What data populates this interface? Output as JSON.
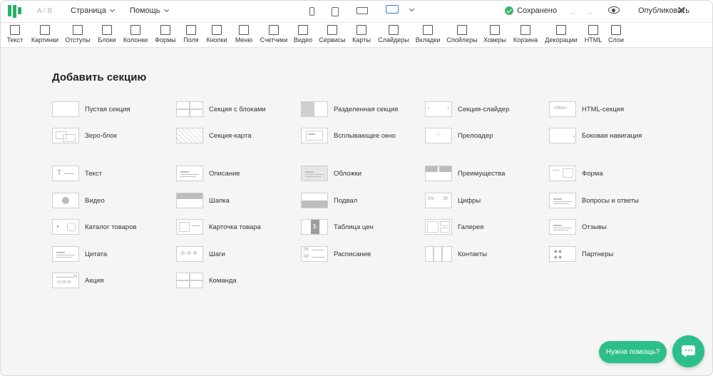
{
  "topbar": {
    "ab": "A / B",
    "page_menu": "Страница",
    "help_menu": "Помощь",
    "saved": "Сохранено",
    "publish": "Опубликовать"
  },
  "toolbar": [
    "Текст",
    "Картинки",
    "Отступы",
    "Блоки",
    "Колонки",
    "Формы",
    "Поля",
    "Кнопки",
    "Меню",
    "Счетчики",
    "Видео",
    "Сервисы",
    "Карты",
    "Слайдеры",
    "Вкладки",
    "Спойлеры",
    "Ховеры",
    "Корзина",
    "Декорации",
    "HTML",
    "Слои"
  ],
  "main": {
    "heading": "Добавить секцию",
    "group1": [
      "Пустая секция",
      "Секция с блоками",
      "Разделенная секция",
      "Секция-слайдер",
      "HTML-секция",
      "Зеро-блок",
      "Секция-карта",
      "Всплывающее окно",
      "Прелоадер",
      "Боковая навигация"
    ],
    "group2": [
      "Текст",
      "Описание",
      "Обложки",
      "Преимущества",
      "Форма",
      "Видео",
      "Шапка",
      "Подвал",
      "Цифры",
      "Вопросы и ответы",
      "Каталог товаров",
      "Карточка товара",
      "Таблица цен",
      "Галерея",
      "Отзывы",
      "Цитата",
      "Шаги",
      "Расписание",
      "Контакты",
      "Партнеры",
      "Акция",
      "Команда"
    ],
    "thumb_text": {
      "html": "<html>",
      "digits_a": "5%",
      "digits_b": "28",
      "promo_pct": "%",
      "promo_time": "01:00:30",
      "schedule_a": "06",
      "schedule_b": "08",
      "price_sym": "$"
    }
  },
  "help": {
    "label": "Нужна помощь?"
  },
  "colors": {
    "accent": "#2cbf8a",
    "saved": "#3bb36a",
    "device_active": "#3a7bd5"
  }
}
